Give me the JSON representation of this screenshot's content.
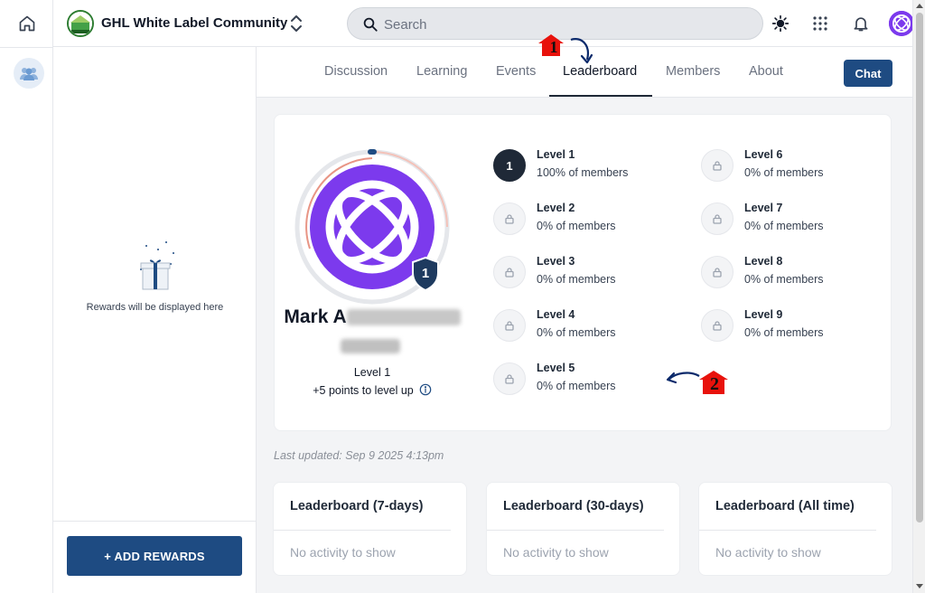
{
  "header": {
    "community_name": "GHL White Label Community",
    "search_placeholder": "Search"
  },
  "tabs": [
    {
      "label": "Discussion"
    },
    {
      "label": "Learning"
    },
    {
      "label": "Events"
    },
    {
      "label": "Leaderboard",
      "active": true
    },
    {
      "label": "Members"
    },
    {
      "label": "About"
    }
  ],
  "chat_label": "Chat",
  "sidebar": {
    "rewards_empty_text": "Rewards will be displayed here",
    "add_rewards_label": "+ ADD REWARDS"
  },
  "profile": {
    "name_visible": "Mark A",
    "badge_level": "1",
    "level_label": "Level 1",
    "points_to_level_up": "+5 points to level up"
  },
  "levels": [
    {
      "title": "Level 1",
      "subtitle": "100% of members",
      "badge": "1",
      "current": true
    },
    {
      "title": "Level 2",
      "subtitle": "0% of members",
      "locked": true
    },
    {
      "title": "Level 3",
      "subtitle": "0% of members",
      "locked": true
    },
    {
      "title": "Level 4",
      "subtitle": "0% of members",
      "locked": true
    },
    {
      "title": "Level 5",
      "subtitle": "0% of members",
      "locked": true
    },
    {
      "title": "Level 6",
      "subtitle": "0% of members",
      "locked": true
    },
    {
      "title": "Level 7",
      "subtitle": "0% of members",
      "locked": true
    },
    {
      "title": "Level 8",
      "subtitle": "0% of members",
      "locked": true
    },
    {
      "title": "Level 9",
      "subtitle": "0% of members",
      "locked": true
    }
  ],
  "last_updated": "Last updated: Sep 9 2025 4:13pm",
  "leaderboards": [
    {
      "title": "Leaderboard (7-days)",
      "empty": "No activity to show"
    },
    {
      "title": "Leaderboard (30-days)",
      "empty": "No activity to show"
    },
    {
      "title": "Leaderboard (All time)",
      "empty": "No activity to show"
    }
  ],
  "annotations": [
    {
      "number": "1"
    },
    {
      "number": "2"
    }
  ],
  "colors": {
    "brand_blue": "#1e4b82",
    "avatar_purple": "#7c3aed",
    "annotation_red": "#e8120c",
    "annotation_arrow": "#0b2a6b"
  },
  "icons": [
    "home-icon",
    "community-icon",
    "gift-icon",
    "chevron-up-down-icon",
    "search-icon",
    "sun-icon",
    "apps-grid-icon",
    "bell-icon",
    "lock-icon",
    "info-icon"
  ]
}
